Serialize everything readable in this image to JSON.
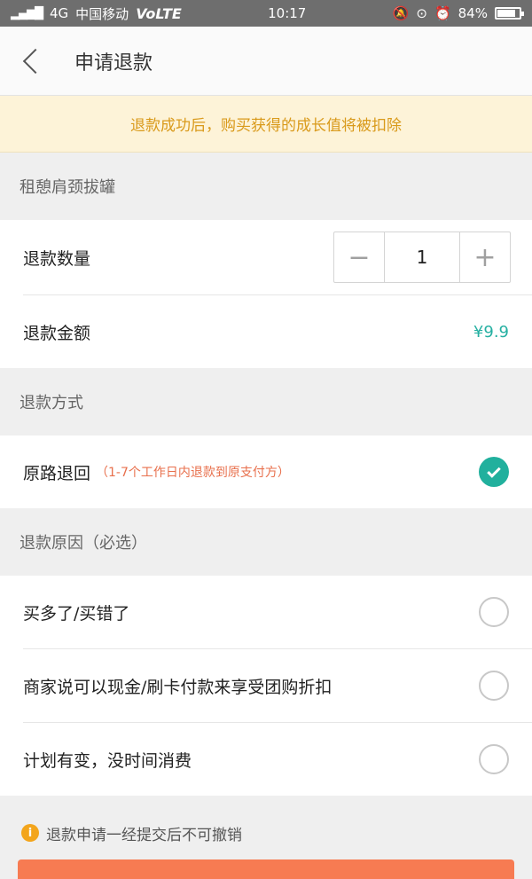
{
  "status_bar": {
    "carrier": "中国移动",
    "network": "4G",
    "volte": "VoLTE",
    "time": "10:17",
    "battery_text": "84%",
    "battery_level": 0.84
  },
  "nav": {
    "title": "申请退款"
  },
  "notice": {
    "text": "退款成功后，购买获得的成长值将被扣除"
  },
  "item": {
    "name": "租憩肩颈拔罐"
  },
  "quantity": {
    "label": "退款数量",
    "value": "1",
    "minus": "−",
    "plus": "+"
  },
  "amount": {
    "label": "退款金额",
    "value": "¥9.9"
  },
  "method": {
    "header": "退款方式",
    "option_label": "原路退回",
    "option_note": "（1-7个工作日内退款到原支付方）",
    "selected": true
  },
  "reasons": {
    "header": "退款原因（必选）",
    "items": [
      {
        "label": "买多了/买错了"
      },
      {
        "label": "商家说可以现金/刷卡付款来享受团购折扣"
      },
      {
        "label": "计划有变，没时间消费"
      }
    ]
  },
  "footer": {
    "info_icon": "i",
    "tip": "退款申请一经提交后不可撤销"
  },
  "colors": {
    "accent": "#21b09d",
    "notice_text": "#d99a1b",
    "note_text": "#e8704d",
    "submit": "#f77b52"
  }
}
